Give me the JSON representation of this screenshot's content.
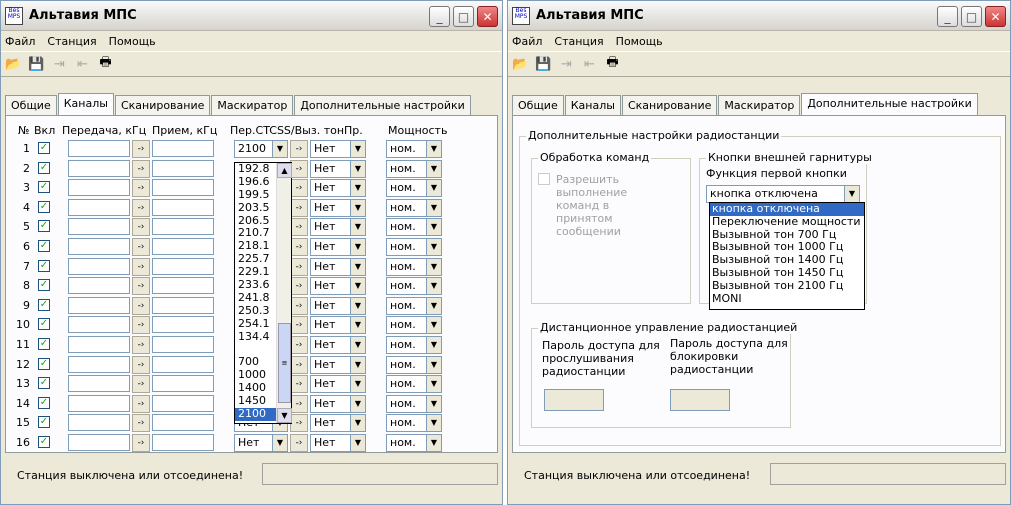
{
  "window1": {
    "title": "Альтавия МПС",
    "menu": [
      "Файл",
      "Станция",
      "Помощь"
    ],
    "tabs": [
      "Общие",
      "Каналы",
      "Сканирование",
      "Маскиратор",
      "Дополнительные настройки"
    ],
    "active_tab": "Каналы",
    "headers": {
      "num": "№",
      "on": "Вкл",
      "tx": "Передача, кГц",
      "rx": "Прием, кГц",
      "ctcss": "Пер.CTCSS/Выз. тон",
      "pr": "Пр.",
      "power": "Мощность"
    },
    "rows": [
      {
        "n": "1",
        "ctcss": "2100",
        "pr": "Нет",
        "power": "ном."
      },
      {
        "n": "2",
        "ctcss": "",
        "pr": "Нет",
        "power": "ном."
      },
      {
        "n": "3",
        "ctcss": "",
        "pr": "Нет",
        "power": "ном."
      },
      {
        "n": "4",
        "ctcss": "",
        "pr": "Нет",
        "power": "ном."
      },
      {
        "n": "5",
        "ctcss": "",
        "pr": "Нет",
        "power": "ном."
      },
      {
        "n": "6",
        "ctcss": "",
        "pr": "Нет",
        "power": "ном."
      },
      {
        "n": "7",
        "ctcss": "",
        "pr": "Нет",
        "power": "ном."
      },
      {
        "n": "8",
        "ctcss": "",
        "pr": "Нет",
        "power": "ном."
      },
      {
        "n": "9",
        "ctcss": "",
        "pr": "Нет",
        "power": "ном."
      },
      {
        "n": "10",
        "ctcss": "",
        "pr": "Нет",
        "power": "ном."
      },
      {
        "n": "11",
        "ctcss": "",
        "pr": "Нет",
        "power": "ном."
      },
      {
        "n": "12",
        "ctcss": "",
        "pr": "Нет",
        "power": "ном."
      },
      {
        "n": "13",
        "ctcss": "",
        "pr": "Нет",
        "power": "ном."
      },
      {
        "n": "14",
        "ctcss": "",
        "pr": "Нет",
        "power": "ном."
      },
      {
        "n": "15",
        "ctcss": "Нет",
        "pr": "Нет",
        "power": "ном."
      },
      {
        "n": "16",
        "ctcss": "Нет",
        "pr": "Нет",
        "power": "ном."
      }
    ],
    "ctcss_list": [
      "192.8",
      "196.6",
      "199.5",
      "203.5",
      "206.5",
      "210.7",
      "218.1",
      "225.7",
      "229.1",
      "233.6",
      "241.8",
      "250.3",
      "254.1",
      "134.4",
      "",
      "700",
      "1000",
      "1400",
      "1450",
      "2100"
    ],
    "ctcss_selected": "2100",
    "status": "Станция выключена или отсоединена!",
    "status_dot_color": "#0a22e6"
  },
  "window2": {
    "title": "Альтавия МПС",
    "menu": [
      "Файл",
      "Станция",
      "Помощь"
    ],
    "tabs": [
      "Общие",
      "Каналы",
      "Сканирование",
      "Маскиратор",
      "Дополнительные настройки"
    ],
    "active_tab": "Дополнительные настройки",
    "outer_group": "Дополнительные настройки радиостанции",
    "cmd_group": "Обработка команд",
    "cmd_checkbox": [
      "Разрешить",
      "выполнение",
      "команд в",
      "принятом",
      "сообщении"
    ],
    "headset_group": "Кнопки внешней гарнитуры",
    "first_button_label": "Функция первой кнопки",
    "first_button_value": "кнопка отключена",
    "first_button_options": [
      "кнопка отключена",
      "Переключение мощности",
      "Вызывной тон 700 Гц",
      "Вызывной тон 1000 Гц",
      "Вызывной тон 1400 Гц",
      "Вызывной тон 1450 Гц",
      "Вызывной тон 2100 Гц",
      "MONI"
    ],
    "remote_group": "Дистанционное управление радиостанцией",
    "listen_pw": [
      "Пароль доступа для",
      "прослушивания",
      "радиостанции"
    ],
    "block_pw": [
      "Пароль доступа для",
      "блокировки",
      "радиостанции"
    ],
    "status": "Станция выключена или отсоединена!"
  }
}
